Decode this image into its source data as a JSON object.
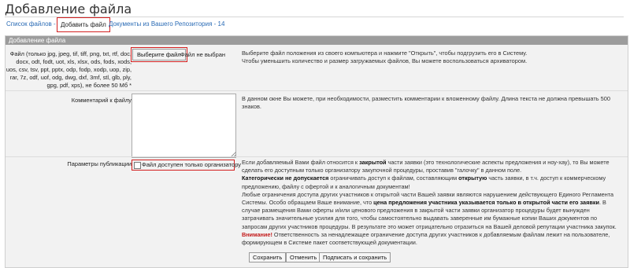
{
  "page": {
    "title": "Добавление файла"
  },
  "tabs": [
    {
      "label": "Список файлов - 0"
    },
    {
      "label": "Добавить файл"
    },
    {
      "label": "Документы из Вашего Репозитория - 14"
    }
  ],
  "section": {
    "header": "Добавление файла"
  },
  "file_row": {
    "label": "Файл (только jpg, jpeg, tif, tiff, png, txt, rtf, doc, docx, odt, fodt, uot, xls, xlsx, ods, fods, xods, uos, csv, tsv, ppt, pptx, odp, fodp, xodp, uop, zip, rar, 7z, odf, uof, odg, dwg, dxf, 3mf, stl, glb, ply, gpg, pdf, xps), не более 50 Мб *",
    "choose_button": "Выберите файл",
    "no_file_text": "Файл не выбран",
    "help_line1": "Выберите файл положения из своего компьютера и нажмите \"Открыть\", чтобы подгрузить его в Систему.",
    "help_line2": "Чтобы уменьшить количество и размер загружаемых файлов, Вы можете воспользоваться архиватором."
  },
  "comment_row": {
    "label": "Комментарий к файлу",
    "value": "",
    "help": "В данном окне Вы можете, при необходимости, разместить комментарии к вложенному файлу. Длина текста не должна превышать 500 знаков."
  },
  "publication_row": {
    "label": "Параметры публикации",
    "checkbox_label": "Файл доступен только организатору",
    "checked": false,
    "p1_a": "Если добавляемый Вами файл относится к ",
    "p1_b": "закрытой",
    "p1_c": " части заявки (это технологические аспекты предложения и ноу-хау), то Вы можете сделать его доступным только организатору закупочной процедуры, проставив \"галочку\" в данном поле.",
    "p2_a": "Категорически не допускается",
    "p2_b": " ограничивать доступ к файлам, составляющим ",
    "p2_c": "открытую",
    "p2_d": " часть заявки, в т.ч. доступ к коммерческому предложению, файлу с офертой и к аналогичным документам!",
    "p3_a": "Любые ограничения доступа других участников к открытой части Вашей заявки являются нарушением действующего Единого Регламента Системы. Особо обращаем Ваше внимание, что ",
    "p3_b": "цена предложения участника указывается только в открытой части его заявки",
    "p3_c": ". В случае размещения Вами оферты и/или ценового предложения в закрытой части заявки организатор процедуры будет вынужден затрачивать значительные усилия для того, чтобы самостоятельно выдавать заверенные им бумажные копии Ваших документов по запросам других участников процедуры. В результате это может отрицательно отразиться на Вашей деловой репутации участника закупок.",
    "p4_a": "Внимание!",
    "p4_b": " Ответственность за ненадлежащее ограничение доступа других участников к добавляемым файлам лежит на пользователе, формирующем в Системе пакет соответствующей документации."
  },
  "buttons": {
    "save": "Сохранить",
    "cancel": "Отменить",
    "sign_save": "Подписать и сохранить"
  },
  "colors": {
    "highlight": "#d31f1f",
    "link": "#2a6bb5",
    "header_bg": "#9c9c9c"
  }
}
